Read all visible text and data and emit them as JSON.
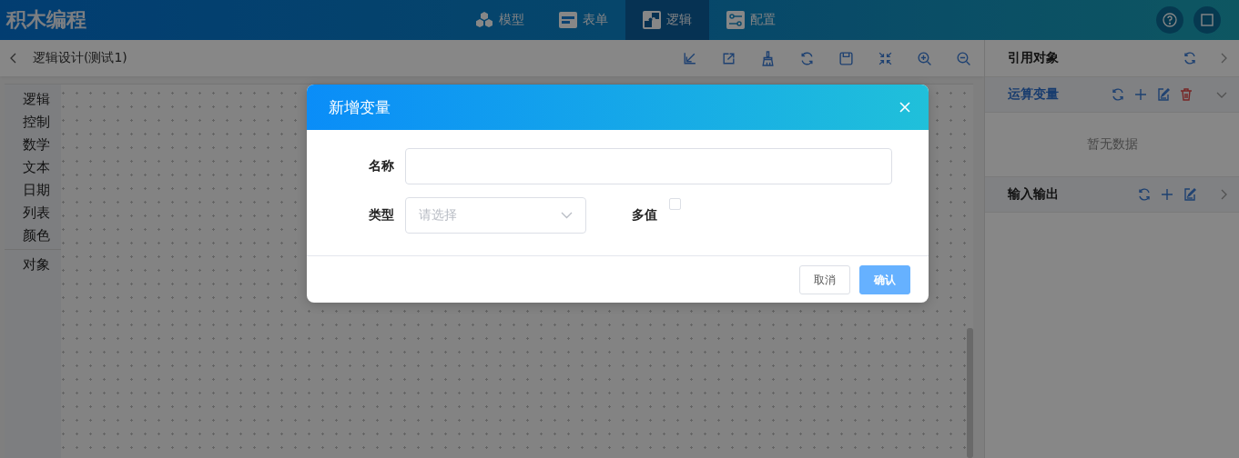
{
  "app": {
    "title": "积木编程"
  },
  "nav_tabs": [
    {
      "label": "模型",
      "selected": false
    },
    {
      "label": "表单",
      "selected": false
    },
    {
      "label": "逻辑",
      "selected": true
    },
    {
      "label": "配置",
      "selected": false
    }
  ],
  "toolbar": {
    "title": "逻辑设计(测试1)"
  },
  "category_groups": [
    [
      "逻辑",
      "控制",
      "数学",
      "文本",
      "日期",
      "列表",
      "颜色"
    ],
    [
      "对象"
    ]
  ],
  "right_panel": {
    "title": "引用对象",
    "sections": [
      {
        "title": "运算变量",
        "expanded": true,
        "deletable": true,
        "empty_text": "暂无数据"
      },
      {
        "title": "输入输出",
        "expanded": false,
        "deletable": false
      }
    ]
  },
  "dialog": {
    "title": "新增变量",
    "rows": [
      [
        {
          "kind": "text",
          "label": "名称"
        }
      ],
      [
        {
          "kind": "select",
          "label": "类型",
          "placeholder": "请选择"
        },
        {
          "kind": "checkbox",
          "label": "多值",
          "checked": false
        }
      ]
    ],
    "buttons": [
      {
        "label": "取消",
        "kind": "default"
      },
      {
        "label": "确认",
        "kind": "primary"
      }
    ]
  }
}
